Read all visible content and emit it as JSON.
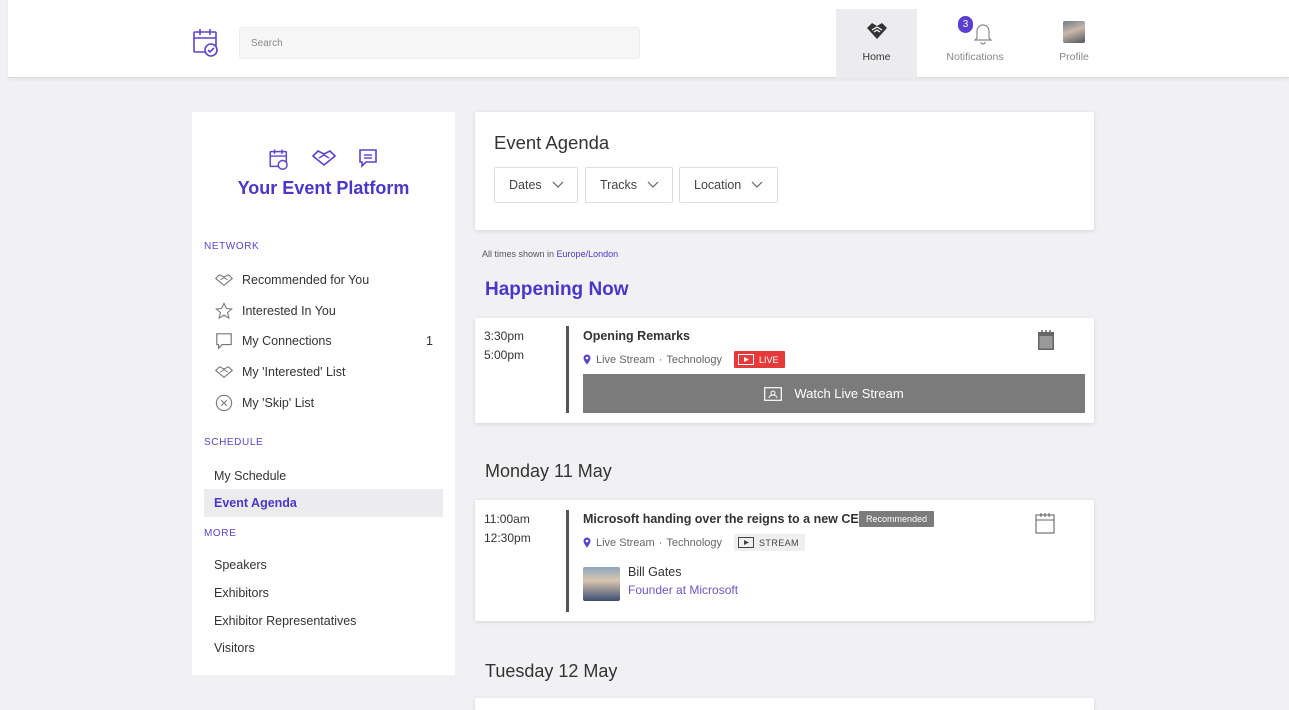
{
  "topbar": {
    "search_placeholder": "Search",
    "nav": [
      {
        "label": "Home",
        "icon": "handshake-icon",
        "active": true
      },
      {
        "label": "Notifications",
        "icon": "bell-icon",
        "badge": "3"
      },
      {
        "label": "Profile",
        "icon": "avatar"
      }
    ]
  },
  "sidebar": {
    "brand_title": "Your Event Platform",
    "sections": {
      "network": "NETWORK",
      "schedule": "SCHEDULE",
      "more": "MORE"
    },
    "network_items": [
      {
        "label": "Recommended for You",
        "icon": "handshake-icon"
      },
      {
        "label": "Interested In You",
        "icon": "star-icon"
      },
      {
        "label": "My Connections",
        "icon": "chat-icon",
        "count": "1"
      },
      {
        "label": "My 'Interested' List",
        "icon": "handshake-icon"
      },
      {
        "label": "My 'Skip' List",
        "icon": "close-circle-icon"
      }
    ],
    "schedule_items": [
      {
        "label": "My Schedule"
      },
      {
        "label": "Event Agenda",
        "active": true
      }
    ],
    "more_items": [
      {
        "label": "Speakers"
      },
      {
        "label": "Exhibitors"
      },
      {
        "label": "Exhibitor Representatives"
      },
      {
        "label": "Visitors"
      }
    ]
  },
  "agenda": {
    "title": "Event Agenda",
    "filters": [
      "Dates",
      "Tracks",
      "Location"
    ],
    "times_note_prefix": "All times shown in",
    "timezone": "Europe/London",
    "happening_heading": "Happening Now"
  },
  "events": {
    "now": {
      "start": "3:30pm",
      "end": "5:00pm",
      "title": "Opening Remarks",
      "location": "Live Stream",
      "track": "Technology",
      "tag": "LIVE",
      "button": "Watch Live Stream"
    },
    "monday": {
      "day": "Monday 11 May",
      "start": "11:00am",
      "end": "12:30pm",
      "title": "Microsoft handing over the reigns to a new CEO",
      "badge": "Recommended",
      "location": "Live Stream",
      "track": "Technology",
      "tag": "STREAM",
      "speaker_name": "Bill Gates",
      "speaker_role": "Founder at Microsoft"
    },
    "tuesday": {
      "day": "Tuesday 12 May"
    }
  },
  "colors": {
    "brand": "#4a36c9",
    "live": "#e63a3a",
    "button": "#7b7b7b"
  }
}
